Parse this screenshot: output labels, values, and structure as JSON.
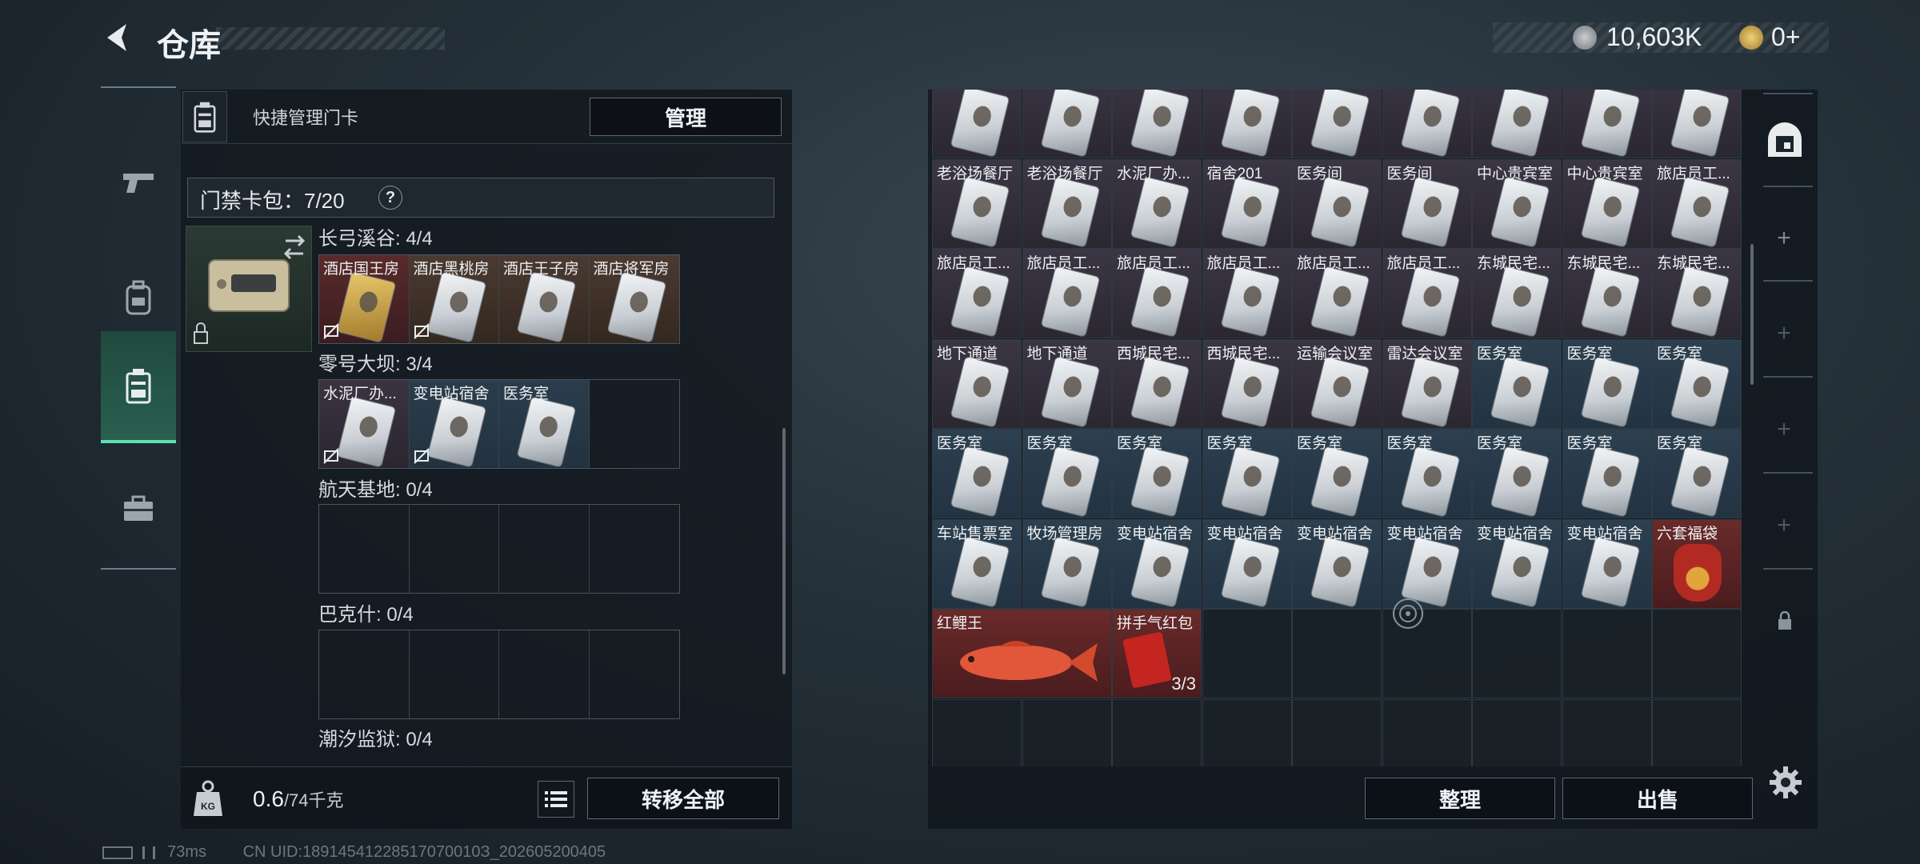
{
  "header": {
    "title": "仓库"
  },
  "currency": {
    "primary": "10,603K",
    "secondary": "0+"
  },
  "quick_manage": {
    "label": "快捷管理门卡",
    "manage_button": "管理"
  },
  "card_bag": {
    "label": "门禁卡包：7/20",
    "help": "?"
  },
  "regions": [
    {
      "label": "长弓溪谷: 4/4",
      "slots": [
        {
          "name": "酒店国王房",
          "color": "red",
          "no_lock": true
        },
        {
          "name": "酒店黑桃房",
          "color": "brown",
          "no_lock": true
        },
        {
          "name": "酒店王子房",
          "color": "brown",
          "no_lock": false
        },
        {
          "name": "酒店将军房",
          "color": "brown",
          "no_lock": false
        }
      ]
    },
    {
      "label": "零号大坝: 3/4",
      "slots": [
        {
          "name": "水泥厂办...",
          "color": "purple",
          "no_lock": true
        },
        {
          "name": "变电站宿舍",
          "color": "blue",
          "no_lock": true
        },
        {
          "name": "医务室",
          "color": "blue",
          "no_lock": false
        },
        {
          "name": "",
          "color": "empty",
          "no_lock": false
        }
      ]
    },
    {
      "label": "航天基地: 0/4",
      "slots": []
    },
    {
      "label": "巴克什: 0/4",
      "slots": []
    },
    {
      "label": "潮汐监狱: 0/4",
      "slots": []
    }
  ],
  "weight": {
    "current": "0.6",
    "max": "/74千克"
  },
  "transfer_all": "转移全部",
  "grid_rows": [
    [
      {
        "name": "",
        "c": "purple",
        "card": true
      },
      {
        "name": "",
        "c": "purple",
        "card": true
      },
      {
        "name": "",
        "c": "purple",
        "card": true
      },
      {
        "name": "",
        "c": "purple",
        "card": true
      },
      {
        "name": "",
        "c": "purple",
        "card": true
      },
      {
        "name": "",
        "c": "purple",
        "card": true
      },
      {
        "name": "",
        "c": "purple",
        "card": true
      },
      {
        "name": "",
        "c": "purple",
        "card": true
      },
      {
        "name": "",
        "c": "purple",
        "card": true
      }
    ],
    [
      {
        "name": "老浴场餐厅",
        "c": "purple",
        "card": true
      },
      {
        "name": "老浴场餐厅",
        "c": "purple",
        "card": true
      },
      {
        "name": "水泥厂办...",
        "c": "purple",
        "card": true
      },
      {
        "name": "宿舍201",
        "c": "purple",
        "card": true
      },
      {
        "name": "医务间",
        "c": "purple",
        "card": true
      },
      {
        "name": "医务间",
        "c": "purple",
        "card": true
      },
      {
        "name": "中心贵宾室",
        "c": "purple",
        "card": true
      },
      {
        "name": "中心贵宾室",
        "c": "purple",
        "card": true
      },
      {
        "name": "旅店员工...",
        "c": "purple",
        "card": true
      }
    ],
    [
      {
        "name": "旅店员工...",
        "c": "purple",
        "card": true
      },
      {
        "name": "旅店员工...",
        "c": "purple",
        "card": true
      },
      {
        "name": "旅店员工...",
        "c": "purple",
        "card": true
      },
      {
        "name": "旅店员工...",
        "c": "purple",
        "card": true
      },
      {
        "name": "旅店员工...",
        "c": "purple",
        "card": true
      },
      {
        "name": "旅店员工...",
        "c": "purple",
        "card": true
      },
      {
        "name": "东城民宅...",
        "c": "purple",
        "card": true
      },
      {
        "name": "东城民宅...",
        "c": "purple",
        "card": true
      },
      {
        "name": "东城民宅...",
        "c": "purple",
        "card": true
      }
    ],
    [
      {
        "name": "地下通道",
        "c": "purple",
        "card": true
      },
      {
        "name": "地下通道",
        "c": "purple",
        "card": true
      },
      {
        "name": "西城民宅...",
        "c": "purple",
        "card": true
      },
      {
        "name": "西城民宅...",
        "c": "purple",
        "card": true
      },
      {
        "name": "运输会议室",
        "c": "purple",
        "card": true
      },
      {
        "name": "雷达会议室",
        "c": "purple",
        "card": true
      },
      {
        "name": "医务室",
        "c": "blue",
        "card": true
      },
      {
        "name": "医务室",
        "c": "blue",
        "card": true
      },
      {
        "name": "医务室",
        "c": "blue",
        "card": true
      }
    ],
    [
      {
        "name": "医务室",
        "c": "blue",
        "card": true
      },
      {
        "name": "医务室",
        "c": "blue",
        "card": true
      },
      {
        "name": "医务室",
        "c": "blue",
        "card": true
      },
      {
        "name": "医务室",
        "c": "blue",
        "card": true
      },
      {
        "name": "医务室",
        "c": "blue",
        "card": true
      },
      {
        "name": "医务室",
        "c": "blue",
        "card": true
      },
      {
        "name": "医务室",
        "c": "blue",
        "card": true
      },
      {
        "name": "医务室",
        "c": "blue",
        "card": true
      },
      {
        "name": "医务室",
        "c": "blue",
        "card": true
      }
    ],
    [
      {
        "name": "车站售票室",
        "c": "blue",
        "card": true
      },
      {
        "name": "牧场管理房",
        "c": "blue",
        "card": true
      },
      {
        "name": "变电站宿舍",
        "c": "blue",
        "card": true
      },
      {
        "name": "变电站宿舍",
        "c": "blue",
        "card": true
      },
      {
        "name": "变电站宿舍",
        "c": "blue",
        "card": true
      },
      {
        "name": "变电站宿舍",
        "c": "blue",
        "card": true
      },
      {
        "name": "变电站宿舍",
        "c": "blue",
        "card": true
      },
      {
        "name": "变电站宿舍",
        "c": "blue",
        "card": true
      },
      {
        "name": "六套福袋",
        "c": "red",
        "card": false
      }
    ]
  ],
  "special_items": {
    "fish": "红鲤王",
    "envelope": "拼手气红包",
    "envelope_count": "3/3"
  },
  "buttons": {
    "organize": "整理",
    "sell": "出售"
  },
  "status": {
    "ping": "73ms",
    "uid": "CN UID:18914541228517070010З_202605200405"
  }
}
